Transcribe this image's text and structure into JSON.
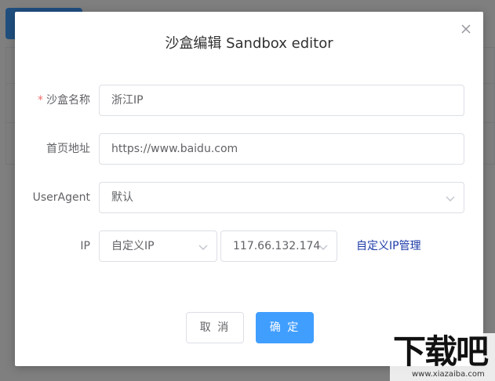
{
  "dialog": {
    "title": "沙盒编辑 Sandbox editor",
    "close_icon": "close-icon"
  },
  "form": {
    "name": {
      "label": "沙盒名称",
      "required_mark": "*",
      "value": "浙江IP"
    },
    "homepage": {
      "label": "首页地址",
      "value": "https://www.baidu.com"
    },
    "useragent": {
      "label": "UserAgent",
      "selected": "默认"
    },
    "ip": {
      "label": "IP",
      "mode_selected": "自定义IP",
      "address_selected": "117.66.132.174",
      "manage_link": "自定义IP管理"
    }
  },
  "buttons": {
    "cancel": "取 消",
    "confirm": "确 定"
  },
  "colors": {
    "primary": "#409eff",
    "link": "#1d3ba8",
    "required": "#f56c6c"
  },
  "watermark": {
    "text": "下载吧",
    "url": "www.xiazaiba.com"
  }
}
